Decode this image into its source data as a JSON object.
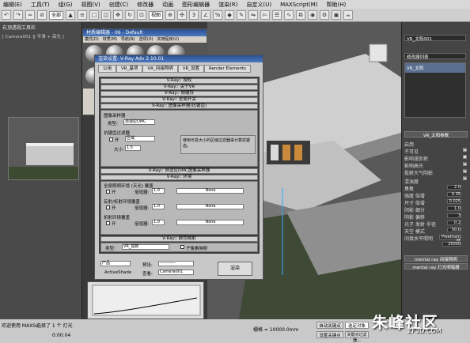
{
  "menubar": {
    "items": [
      "编辑(E)",
      "工具(T)",
      "组(G)",
      "视图(V)",
      "创建(C)",
      "修改器",
      "动画",
      "图形编辑器",
      "渲染(R)",
      "自定义(U)",
      "MAXScript(M)",
      "帮助(H)"
    ]
  },
  "toolbar": {
    "selection_filter": "全部",
    "view_dropdown": "视图"
  },
  "left_viewport": {
    "label": "右顶透视工具栏",
    "camera_label": "[ Camera001 ][ 平滑 + 高光 ]"
  },
  "material_editor": {
    "title": "材质编辑器 - 06 - Default",
    "menu": [
      "模式(D)",
      "材质(M)",
      "导航(N)",
      "选项(O)",
      "实用程序(U)"
    ]
  },
  "render_setup": {
    "title": "渲染设置: V-Ray Adv 2.10.01",
    "tabs": [
      "公用",
      "VR_基项",
      "VR_间接照明",
      "VR_设置",
      "Render Elements"
    ],
    "rollouts": [
      "V-Ray:: 授权",
      "V-Ray:: 关于VR",
      "V-Ray:: 帧缓存",
      "V-Ray:: 全局开关",
      "V-Ray:: 图像采样器(抗锯齿)"
    ],
    "image_sampler": {
      "section": "图像采样器",
      "type_label": "类型:",
      "type_value": "自适应DMC"
    },
    "aa_filter": {
      "section": "抗锯齿过滤器",
      "on_label": "开",
      "filter_value": "区域",
      "size_label": "大小:",
      "size_value": "1.5",
      "description": "使用可变大小的区域过滤器来计算抗锯齿。"
    },
    "rollouts2": [
      "V-Ray:: 自适应DMC图像采样器",
      "V-Ray:: 环境"
    ],
    "environment": {
      "gi_section": "全局照明环境 (天光) 覆盖",
      "gi_on": "开",
      "gi_multiplier_label": "倍增器:",
      "gi_multiplier": "1.0",
      "gi_map": "None",
      "refl_section": "反射/折射环境覆盖",
      "refl_on": "开",
      "refl_multiplier_label": "倍增器:",
      "refl_multiplier": "1.0",
      "refl_map": "None",
      "refr_section": "折射环境覆盖",
      "refr_on": "开",
      "refr_multiplier_label": "倍增器:",
      "refr_multiplier": "1.0",
      "refr_map": "None"
    },
    "color_mapping": {
      "rollout": "V-Ray:: 颜色映射",
      "type_label": "类型:",
      "type_value": "VR_指数",
      "sub_pixel": "子像素映射"
    },
    "bottom": {
      "product_label": "产品",
      "preset_label": "预设:",
      "preset_value": "-----------",
      "view_label": "查看:",
      "view_value": "Camera001",
      "render_button": "渲染",
      "activeshade": "ActiveShade"
    }
  },
  "command_panel": {
    "object_name": "VR_太阳001",
    "modifier_list": "修改器列表",
    "stack_item": "VR_太阳",
    "params_title": "VR_太阳参数",
    "params": [
      {
        "label": "启用",
        "value": ""
      },
      {
        "label": "不可见",
        "value": ""
      },
      {
        "label": "影响漫反射",
        "value": ""
      },
      {
        "label": "影响高光",
        "value": ""
      },
      {
        "label": "投射大气阴影",
        "value": ""
      },
      {
        "label": "混浊度",
        "value": "2.0"
      },
      {
        "label": "臭氧",
        "value": "0.35"
      },
      {
        "label": "强度 倍增",
        "value": "0.025"
      },
      {
        "label": "尺寸 倍增",
        "value": "1.0"
      },
      {
        "label": "阴影 细分",
        "value": "3"
      },
      {
        "label": "阴影 偏移",
        "value": "0.2"
      },
      {
        "label": "光子 发射 半径",
        "value": "50.0"
      },
      {
        "label": "天空 模式",
        "value": "Preetham et"
      },
      {
        "label": "间接水平照明",
        "value": "25000"
      }
    ],
    "rollouts": [
      "mental ray 间接照明",
      "mental ray 灯光明暗器"
    ]
  },
  "status": {
    "selection": "选择了 1 个 灯光",
    "left_text": "欢迎使用 MAXSc",
    "time_value": "0:00:04",
    "grid": "栅格 = 10000.0mm",
    "auto_key": "自动关键点",
    "selected_label": "选定对象",
    "set_key": "设置关键点",
    "key_filters": "关键点过滤器..."
  },
  "watermark": {
    "text": "朱峰社区",
    "sub": "ZF3D.COM"
  }
}
